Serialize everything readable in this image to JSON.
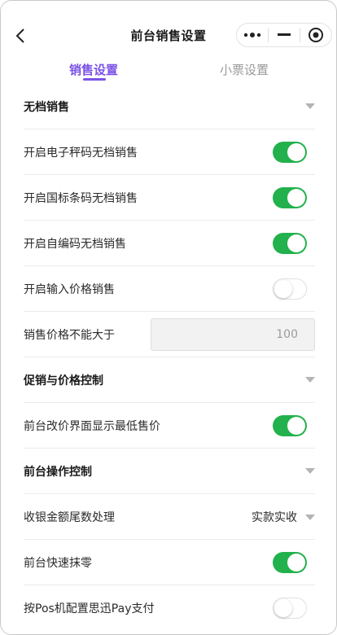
{
  "header": {
    "title": "前台销售设置",
    "back_icon": "chevron-left-icon",
    "capsule": {
      "more_icon": "more-dots-icon",
      "minimize_icon": "minimize-icon",
      "close_icon": "target-close-icon"
    }
  },
  "tabs": [
    {
      "label": "销售设置",
      "active": true
    },
    {
      "label": "小票设置",
      "active": false
    }
  ],
  "colors": {
    "accent": "#7b52e6",
    "toggle_on": "#22b14c"
  },
  "sections": {
    "no_barcode": {
      "title": "无档销售",
      "items": [
        {
          "label": "开启电子秤码无档销售",
          "enabled": true
        },
        {
          "label": "开启国标条码无档销售",
          "enabled": true
        },
        {
          "label": "开启自编码无档销售",
          "enabled": true
        },
        {
          "label": "开启输入价格销售",
          "enabled": false
        }
      ],
      "max_price": {
        "label": "销售价格不能大于",
        "value": "100"
      }
    },
    "promo": {
      "title": "促销与价格控制",
      "items": [
        {
          "label": "前台改价界面显示最低售价",
          "enabled": true
        }
      ]
    },
    "operation": {
      "title": "前台操作控制",
      "rounding": {
        "label": "收银金额尾数处理",
        "value": "实款实收"
      },
      "items": [
        {
          "label": "前台快速抹零",
          "enabled": true
        },
        {
          "label": "按Pos机配置思迅Pay支付",
          "enabled": false
        }
      ]
    }
  }
}
